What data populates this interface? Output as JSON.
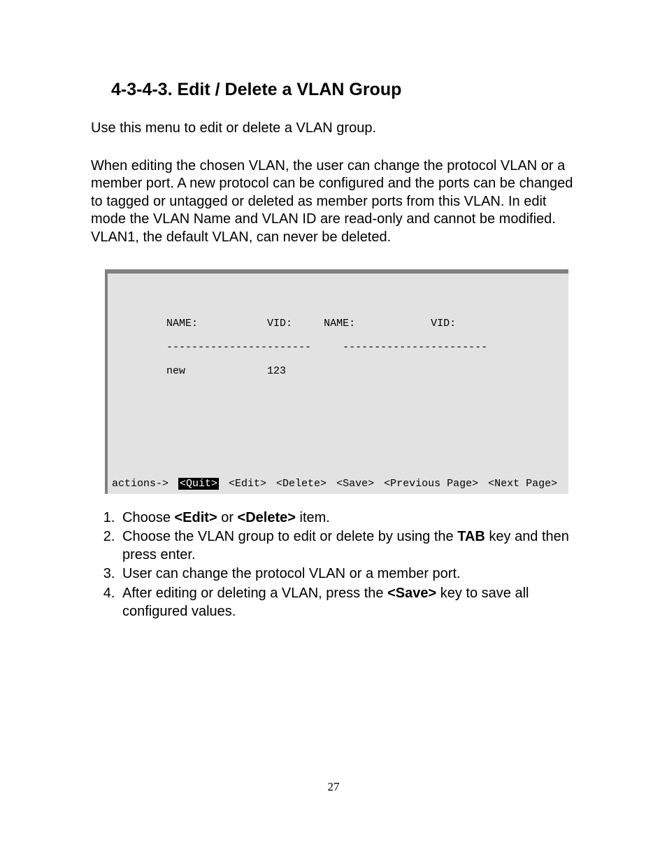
{
  "heading": "4-3-4-3. Edit / Delete a VLAN Group",
  "intro": "Use this menu to edit or delete a VLAN group.",
  "body_paragraph": "When editing the chosen VLAN, the user can change the protocol VLAN or a member port.  A new protocol can be configured and the ports can be changed to tagged or untagged or deleted as member ports from this VLAN. In edit mode the VLAN Name and VLAN ID are read-only and cannot be modified. VLAN1, the default VLAN, can never be deleted.",
  "terminal": {
    "columns": {
      "left_name_header": "NAME:",
      "left_vid_header": "VID:",
      "right_name_header": "NAME:",
      "right_vid_header": "VID:"
    },
    "left_rows": [
      {
        "name": "new",
        "vid": "123"
      }
    ],
    "right_rows": [],
    "dashes_left": "-----------------------",
    "dashes_right": "-----------------------",
    "actions_label": "actions->",
    "actions": [
      {
        "label": "<Quit>",
        "selected": true
      },
      {
        "label": "<Edit>",
        "selected": false
      },
      {
        "label": "<Delete>",
        "selected": false
      },
      {
        "label": "<Save>",
        "selected": false
      },
      {
        "label": "<Previous Page>",
        "selected": false
      },
      {
        "label": "<Next Page>",
        "selected": false
      }
    ]
  },
  "steps": {
    "s1_a": "Choose ",
    "s1_b": "<Edit>",
    "s1_c": " or ",
    "s1_d": "<Delete>",
    "s1_e": " item.",
    "s2_a": "Choose the VLAN group to edit or delete by using the ",
    "s2_b": "TAB",
    "s2_c": " key and then press enter.",
    "s3": "User can change the protocol VLAN or a member port.",
    "s4_a": "After editing or deleting a VLAN, press the ",
    "s4_b": "<Save>",
    "s4_c": " key to save all configured values."
  },
  "page_number": "27"
}
